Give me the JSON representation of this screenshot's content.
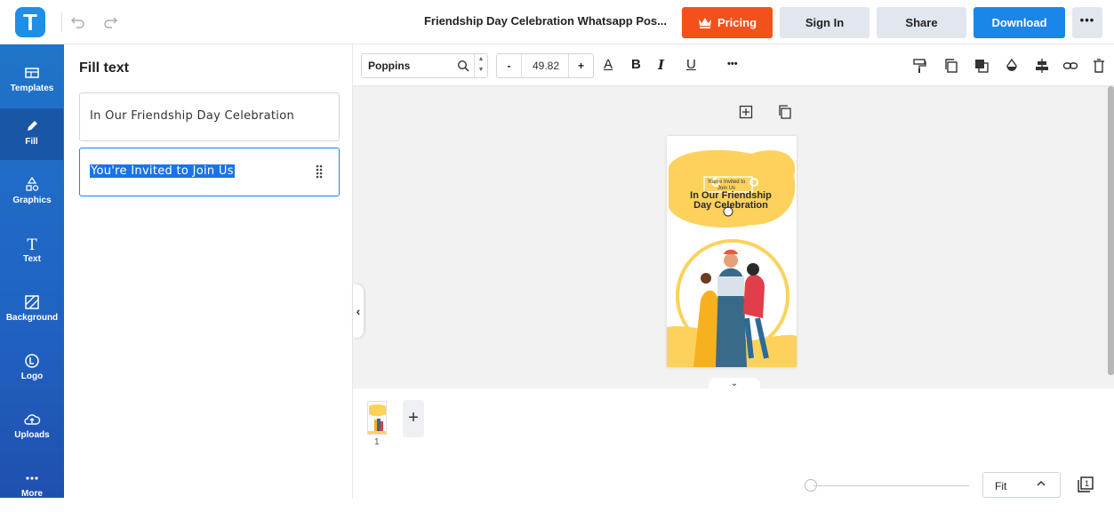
{
  "app": {
    "logo_letter": "T"
  },
  "header": {
    "doc_title": "Friendship Day Celebration Whatsapp Pos...",
    "pricing_label": "Pricing",
    "signin_label": "Sign In",
    "share_label": "Share",
    "download_label": "Download",
    "more_label": "•••"
  },
  "sidebar": {
    "items": [
      {
        "label": "Templates",
        "icon": "templates-icon"
      },
      {
        "label": "Fill",
        "icon": "pencil-icon"
      },
      {
        "label": "Graphics",
        "icon": "shapes-icon"
      },
      {
        "label": "Text",
        "icon": "text-icon"
      },
      {
        "label": "Background",
        "icon": "background-icon"
      },
      {
        "label": "Logo",
        "icon": "logo-icon"
      },
      {
        "label": "Uploads",
        "icon": "upload-icon"
      },
      {
        "label": "More",
        "icon": "more-icon"
      }
    ]
  },
  "panel": {
    "title": "Fill text",
    "fields": [
      {
        "value": "In Our Friendship Day Celebration"
      },
      {
        "value": "You're Invited to Join Us"
      }
    ]
  },
  "toolbar": {
    "font_name": "Poppins",
    "font_size": "49.82",
    "minus_label": "-",
    "plus_label": "+",
    "color_label": "A",
    "bold_label": "B",
    "italic_label": "I",
    "underline_label": "U",
    "more_label": "•••"
  },
  "canvas": {
    "poster_subtitle": "You're Invited to Join Us",
    "poster_heading": "In Our Friendship Day Celebration"
  },
  "pages": {
    "page_numbers": [
      "1"
    ],
    "add_label": "+",
    "zoom_label": "Fit"
  },
  "colors": {
    "accent": "#1a86e8",
    "pricing": "#f2511b",
    "rail": "#2063c2",
    "poster_yellow": "#fcd25c"
  }
}
